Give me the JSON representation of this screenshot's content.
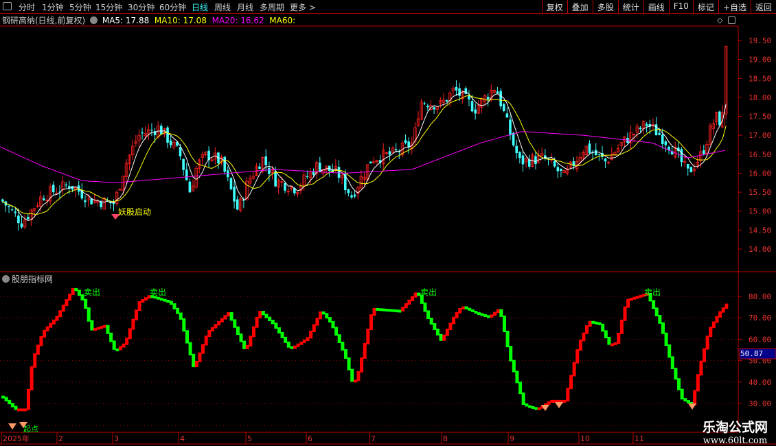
{
  "toolbar": {
    "periods": [
      "分时",
      "1分钟",
      "5分钟",
      "15分钟",
      "30分钟",
      "60分钟",
      "日线",
      "周线",
      "月线",
      "多周期",
      "更多 >"
    ],
    "active": "日线",
    "right": [
      "复权",
      "叠加",
      "多股",
      "统计",
      "画线",
      "F10",
      "标记",
      "+自选",
      "返回"
    ]
  },
  "main": {
    "title": "钢研高纳(日线,前复权)",
    "ma5": "MA5: 17.88",
    "ma10": "MA10: 17.08",
    "ma20": "MA20: 16.62",
    "ma60": "MA60:",
    "signal": "妖股启动",
    "yticks": [
      "19.50",
      "19.00",
      "18.50",
      "18.00",
      "17.50",
      "17.00",
      "16.50",
      "16.00",
      "15.50",
      "15.00",
      "14.50",
      "14.00"
    ]
  },
  "sub": {
    "title": "股朋指标网",
    "sell_label": "卖出",
    "start_label": "起点",
    "current": "50.87",
    "yticks": [
      "80.00",
      "70.00",
      "60.00",
      "50.00",
      "40.00",
      "30.00"
    ]
  },
  "xaxis": [
    "2025年",
    "2",
    "3",
    "4",
    "5",
    "6",
    "7",
    "8",
    "9",
    "10",
    "11"
  ],
  "logo": {
    "name": "乐淘公式网",
    "url": "www.60lt.com"
  },
  "colors": {
    "up": "#ff2020",
    "down": "#40ffff",
    "ma5": "#ffffff",
    "ma10": "#ffff00",
    "ma20": "#ff00ff",
    "ind_up": "#ff0000",
    "ind_down": "#00ff00"
  },
  "chart_data": {
    "type": "candlestick",
    "price_keypoints": [
      [
        0,
        15.3
      ],
      [
        30,
        14.7
      ],
      [
        60,
        15.4
      ],
      [
        100,
        15.7
      ],
      [
        130,
        15.3
      ],
      [
        165,
        15.2
      ],
      [
        180,
        16.2
      ],
      [
        200,
        17.0
      ],
      [
        230,
        17.2
      ],
      [
        260,
        16.5
      ],
      [
        275,
        15.5
      ],
      [
        285,
        16.2
      ],
      [
        300,
        16.5
      ],
      [
        320,
        16.3
      ],
      [
        345,
        15.0
      ],
      [
        360,
        15.8
      ],
      [
        380,
        16.4
      ],
      [
        400,
        15.8
      ],
      [
        430,
        15.6
      ],
      [
        460,
        16.2
      ],
      [
        490,
        16.0
      ],
      [
        510,
        15.4
      ],
      [
        540,
        16.4
      ],
      [
        570,
        16.5
      ],
      [
        600,
        16.8
      ],
      [
        610,
        17.9
      ],
      [
        640,
        17.8
      ],
      [
        660,
        18.2
      ],
      [
        690,
        17.7
      ],
      [
        720,
        18.3
      ],
      [
        745,
        16.8
      ],
      [
        755,
        16.3
      ],
      [
        790,
        16.4
      ],
      [
        820,
        15.9
      ],
      [
        850,
        16.7
      ],
      [
        880,
        16.3
      ],
      [
        910,
        16.9
      ],
      [
        940,
        17.3
      ],
      [
        960,
        17.0
      ],
      [
        980,
        16.6
      ],
      [
        1000,
        16.0
      ],
      [
        1020,
        16.5
      ],
      [
        1040,
        17.5
      ],
      [
        1050,
        17.3
      ],
      [
        1058,
        19.4
      ]
    ],
    "ma60_keypoints": [
      [
        0,
        16.7
      ],
      [
        60,
        16.2
      ],
      [
        120,
        15.8
      ],
      [
        170,
        15.75
      ],
      [
        270,
        15.9
      ],
      [
        400,
        16.1
      ],
      [
        500,
        16.0
      ],
      [
        600,
        16.1
      ],
      [
        700,
        16.8
      ],
      [
        760,
        17.1
      ],
      [
        850,
        17.0
      ],
      [
        950,
        16.8
      ],
      [
        1000,
        16.4
      ],
      [
        1055,
        16.6
      ]
    ],
    "indicator_keypoints": [
      [
        0,
        33
      ],
      [
        20,
        27
      ],
      [
        35,
        27
      ],
      [
        45,
        50
      ],
      [
        60,
        63
      ],
      [
        80,
        70
      ],
      [
        105,
        84
      ],
      [
        120,
        77
      ],
      [
        130,
        64
      ],
      [
        150,
        66
      ],
      [
        165,
        54
      ],
      [
        180,
        58
      ],
      [
        200,
        77
      ],
      [
        215,
        80
      ],
      [
        245,
        77
      ],
      [
        260,
        70
      ],
      [
        280,
        46
      ],
      [
        300,
        63
      ],
      [
        330,
        72
      ],
      [
        355,
        54
      ],
      [
        375,
        73
      ],
      [
        395,
        67
      ],
      [
        420,
        55
      ],
      [
        445,
        60
      ],
      [
        465,
        73
      ],
      [
        480,
        67
      ],
      [
        500,
        52
      ],
      [
        512,
        38
      ],
      [
        520,
        45
      ],
      [
        540,
        74
      ],
      [
        580,
        73
      ],
      [
        605,
        82
      ],
      [
        620,
        70
      ],
      [
        640,
        59
      ],
      [
        660,
        71
      ],
      [
        670,
        75
      ],
      [
        690,
        72
      ],
      [
        710,
        70
      ],
      [
        725,
        74
      ],
      [
        740,
        51
      ],
      [
        760,
        29
      ],
      [
        780,
        27
      ],
      [
        800,
        31
      ],
      [
        820,
        31
      ],
      [
        840,
        57
      ],
      [
        855,
        68
      ],
      [
        870,
        67
      ],
      [
        885,
        57
      ],
      [
        895,
        58
      ],
      [
        910,
        78
      ],
      [
        940,
        81
      ],
      [
        960,
        66
      ],
      [
        975,
        48
      ],
      [
        990,
        32
      ],
      [
        1005,
        29
      ],
      [
        1015,
        45
      ],
      [
        1030,
        64
      ],
      [
        1045,
        72
      ],
      [
        1058,
        77
      ]
    ],
    "price_range": [
      13.7,
      19.9
    ],
    "indicator_range": [
      25,
      88
    ]
  }
}
